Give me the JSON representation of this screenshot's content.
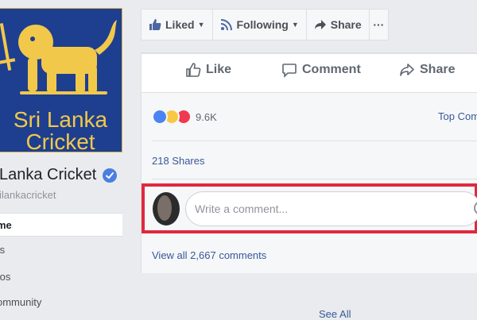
{
  "logo": {
    "line1": "Sri Lanka",
    "line2": "Cricket",
    "bg_color": "#1e3f8f",
    "gold_color": "#f2c84b"
  },
  "page": {
    "name": "Lanka Cricket",
    "handle": "ilankacricket",
    "verified_icon": "verified-badge-icon"
  },
  "nav": {
    "items": [
      {
        "label": "me",
        "active": true
      },
      {
        "label": "ts",
        "active": false
      },
      {
        "label": "tos",
        "active": false
      },
      {
        "label": "ommunity",
        "active": false
      }
    ]
  },
  "action_bar": {
    "liked_label": "Liked",
    "following_label": "Following",
    "share_label": "Share",
    "more_label": "···"
  },
  "post": {
    "like_label": "Like",
    "comment_label": "Comment",
    "share_label": "Share",
    "reaction_count": "9.6K",
    "top_comments_label": "Top Com",
    "shares_label": "218 Shares",
    "comment_placeholder": "Write a comment...",
    "view_all_label": "View all 2,667 comments",
    "see_all_label": "See All"
  },
  "colors": {
    "link": "#385898",
    "highlight_border": "#e0283f",
    "like_blue": "#4b84f2",
    "love_red": "#f0384f",
    "haha_yellow": "#f7c943"
  }
}
